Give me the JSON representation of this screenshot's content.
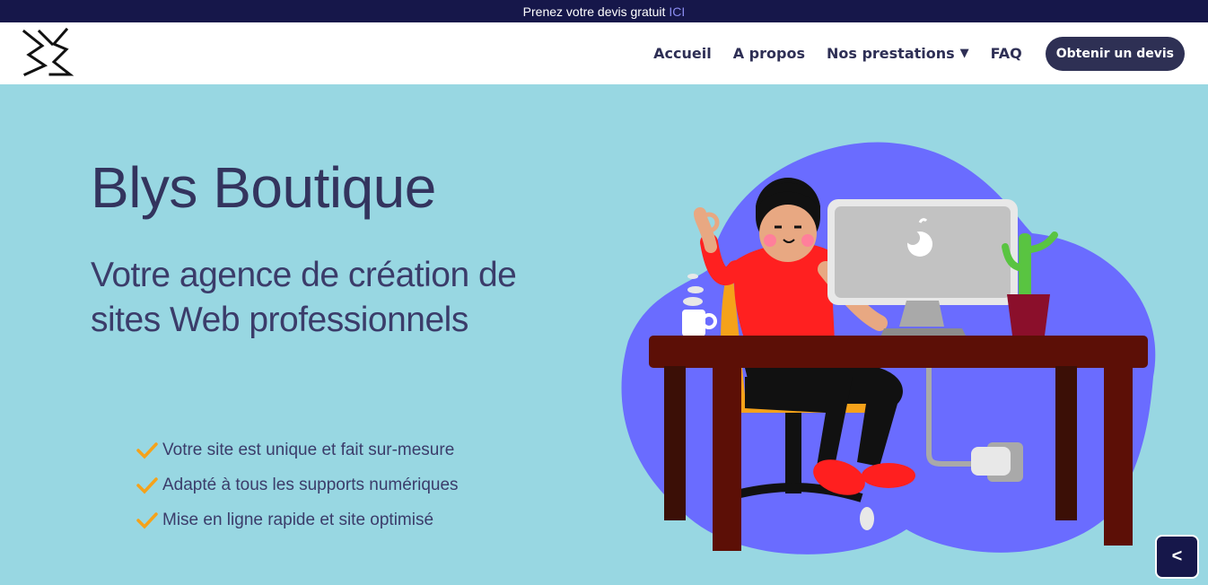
{
  "topbar": {
    "text": "Prenez votre devis gratuit",
    "link": "ICI"
  },
  "header": {
    "logo_icon": "brand-logo",
    "nav": [
      {
        "label": "Accueil"
      },
      {
        "label": "A propos"
      },
      {
        "label": "Nos prestations",
        "caret": "▼"
      },
      {
        "label": "FAQ"
      }
    ],
    "cta": "Obtenir un devis"
  },
  "hero": {
    "title": "Blys Boutique",
    "subtitle": "Votre agence de création de sites Web professionnels",
    "features": [
      "Votre site est unique et fait sur-mesure",
      "Adapté à tous les supports numériques",
      "Mise en ligne rapide et site optimisé"
    ],
    "illustration_icon": "person-at-desk-illustration"
  },
  "back_button": "<",
  "colors": {
    "topbar_bg": "#16174a",
    "hero_bg": "#98d7e2",
    "heading": "#33345e",
    "accent_check": "#f5a21a",
    "blob": "#6a6cff",
    "cta_bg": "#2e3054"
  }
}
